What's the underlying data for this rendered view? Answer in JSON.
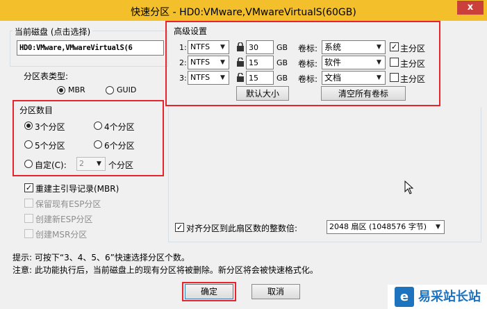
{
  "window": {
    "title": "快速分区 - HD0:VMware,VMwareVirtualS(60GB)",
    "close_glyph": "x",
    "accent": "#f3bf2a",
    "highlight": "#e8232b"
  },
  "current_disk": {
    "label": "当前磁盘 (点击选择)",
    "value": "HD0:VMware,VMwareVirtualS(6"
  },
  "partition_table": {
    "label": "分区表类型:",
    "options": [
      {
        "label": "MBR",
        "selected": true
      },
      {
        "label": "GUID",
        "selected": false
      }
    ]
  },
  "partition_count": {
    "label": "分区数目",
    "options": [
      {
        "label": "3个分区",
        "selected": true
      },
      {
        "label": "4个分区",
        "selected": false
      },
      {
        "label": "5个分区",
        "selected": false
      },
      {
        "label": "6个分区",
        "selected": false
      }
    ],
    "custom": {
      "label": "自定(C):",
      "value": "2",
      "suffix": "个分区",
      "selected": false
    }
  },
  "options": [
    {
      "label": "重建主引导记录(MBR)",
      "checked": true,
      "enabled": true
    },
    {
      "label": "保留现有ESP分区",
      "checked": false,
      "enabled": false
    },
    {
      "label": "创建新ESP分区",
      "checked": false,
      "enabled": false
    },
    {
      "label": "创建MSR分区",
      "checked": false,
      "enabled": false
    }
  ],
  "advanced": {
    "label": "高级设置",
    "unit": "GB",
    "volume_label_caption": "卷标:",
    "primary_caption": "主分区",
    "rows": [
      {
        "index": "1:",
        "fs": "NTFS",
        "locked": true,
        "size": "30",
        "volume": "系统",
        "primary": true
      },
      {
        "index": "2:",
        "fs": "NTFS",
        "locked": false,
        "size": "15",
        "volume": "软件",
        "primary": false
      },
      {
        "index": "3:",
        "fs": "NTFS",
        "locked": false,
        "size": "15",
        "volume": "文档",
        "primary": false
      }
    ],
    "default_size_button": "默认大小",
    "clear_labels_button": "清空所有卷标"
  },
  "align": {
    "label": "对齐分区到此扇区数的整数倍:",
    "checked": true,
    "value": "2048 扇区 (1048576 字节)"
  },
  "tips": {
    "line1": "提示: 可按下“3、4、5、6”快速选择分区个数。",
    "line2": "注意: 此功能执行后，当前磁盘上的现有分区将被删除。新分区将会被快速格式化。"
  },
  "buttons": {
    "ok": "确定",
    "cancel": "取消"
  },
  "watermark": {
    "logo_glyph": "e",
    "text": "易采站长站"
  }
}
